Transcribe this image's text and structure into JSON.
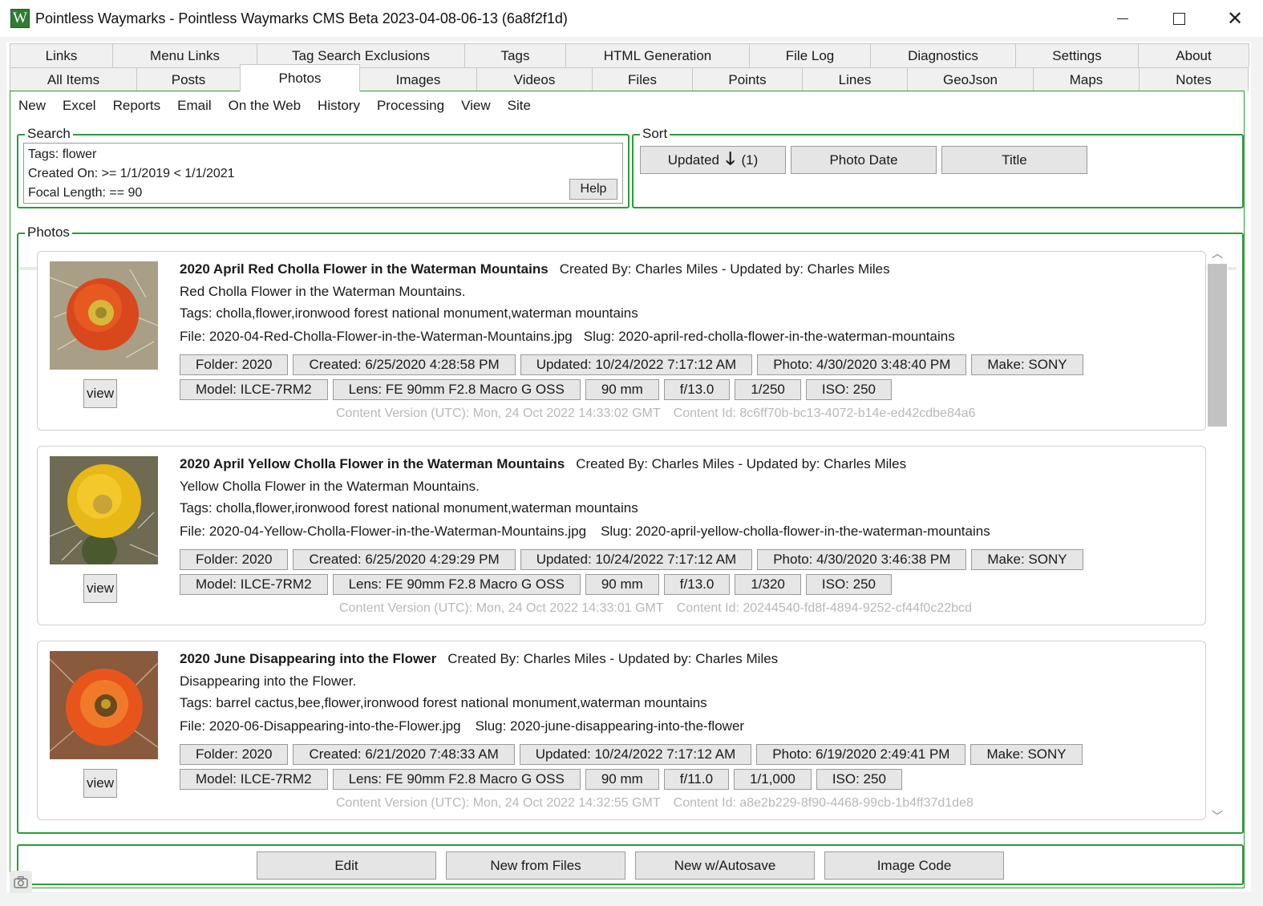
{
  "window": {
    "title": "Pointless Waymarks - Pointless Waymarks CMS Beta   2023-04-08-06-13 (6a8f2f1d)",
    "logo_letter": "W"
  },
  "tabs_top": [
    "Links",
    "Menu Links",
    "Tag Search Exclusions",
    "Tags",
    "HTML Generation",
    "File Log",
    "Diagnostics",
    "Settings",
    "About"
  ],
  "tabs_bottom": [
    "All Items",
    "Posts",
    "Photos",
    "Images",
    "Videos",
    "Files",
    "Points",
    "Lines",
    "GeoJson",
    "Maps",
    "Notes"
  ],
  "active_tab": "Photos",
  "menu": [
    "New",
    "Excel",
    "Reports",
    "Email",
    "On the Web",
    "History",
    "Processing",
    "View",
    "Site"
  ],
  "search": {
    "label": "Search",
    "lines": [
      "Tags: flower",
      "Created On: >= 1/1/2019 < 1/1/2021",
      "Focal Length: == 90"
    ],
    "help_label": "Help"
  },
  "sort": {
    "label": "Sort",
    "updated": "Updated",
    "updated_count": "(1)",
    "photo_date": "Photo Date",
    "title": "Title"
  },
  "photos": {
    "label": "Photos",
    "items": [
      {
        "title": "2020 April Red Cholla Flower in the Waterman Mountains",
        "created_by": "Created By: Charles Miles - Updated by: Charles Miles",
        "summary": "Red Cholla Flower in the Waterman Mountains.",
        "tags": "Tags: cholla,flower,ironwood forest national monument,waterman mountains",
        "file": "File: 2020-04-Red-Cholla-Flower-in-the-Waterman-Mountains.jpg",
        "slug": "Slug: 2020-april-red-cholla-flower-in-the-waterman-mountains",
        "chips1": [
          "Folder: 2020",
          "Created: 6/25/2020 4:28:58 PM",
          "Updated: 10/24/2022 7:17:12 AM",
          "Photo: 4/30/2020 3:48:40 PM",
          "Make: SONY"
        ],
        "chips2": [
          "Model: ILCE-7RM2",
          "Lens: FE 90mm F2.8 Macro G OSS",
          "90 mm",
          "f/13.0",
          "1/250",
          "ISO: 250"
        ],
        "content_version": "Content Version (UTC): Mon, 24 Oct 2022 14:33:02 GMT",
        "content_id": "Content Id: 8c6ff70b-bc13-4072-b14e-ed42cdbe84a6",
        "view_label": "view",
        "color": "#d9481c"
      },
      {
        "title": "2020 April Yellow Cholla Flower in the Waterman Mountains",
        "created_by": "Created By: Charles Miles - Updated by: Charles Miles",
        "summary": "Yellow Cholla Flower in the Waterman Mountains.",
        "tags": "Tags: cholla,flower,ironwood forest national monument,waterman mountains",
        "file": "File: 2020-04-Yellow-Cholla-Flower-in-the-Waterman-Mountains.jpg",
        "slug": "Slug: 2020-april-yellow-cholla-flower-in-the-waterman-mountains",
        "chips1": [
          "Folder: 2020",
          "Created: 6/25/2020 4:29:29 PM",
          "Updated: 10/24/2022 7:17:12 AM",
          "Photo: 4/30/2020 3:46:38 PM",
          "Make: SONY"
        ],
        "chips2": [
          "Model: ILCE-7RM2",
          "Lens: FE 90mm F2.8 Macro G OSS",
          "90 mm",
          "f/13.0",
          "1/320",
          "ISO: 250"
        ],
        "content_version": "Content Version (UTC): Mon, 24 Oct 2022 14:33:01 GMT",
        "content_id": "Content Id: 20244540-fd8f-4894-9252-cf44f0c22bcd",
        "view_label": "view",
        "color": "#e8b816"
      },
      {
        "title": "2020 June Disappearing into the Flower",
        "created_by": "Created By: Charles Miles - Updated by: Charles Miles",
        "summary": "Disappearing into the Flower.",
        "tags": "Tags: barrel cactus,bee,flower,ironwood forest national monument,waterman mountains",
        "file": "File: 2020-06-Disappearing-into-the-Flower.jpg",
        "slug": "Slug: 2020-june-disappearing-into-the-flower",
        "chips1": [
          "Folder: 2020",
          "Created: 6/21/2020 7:48:33 AM",
          "Updated: 10/24/2022 7:17:12 AM",
          "Photo: 6/19/2020 2:49:41 PM",
          "Make: SONY"
        ],
        "chips2": [
          "Model: ILCE-7RM2",
          "Lens: FE 90mm F2.8 Macro G OSS",
          "90 mm",
          "f/11.0",
          "1/1,000",
          "ISO: 250"
        ],
        "content_version": "Content Version (UTC): Mon, 24 Oct 2022 14:32:55 GMT",
        "content_id": "Content Id: a8e2b229-8f90-4468-99cb-1b4ff37d1de8",
        "view_label": "view",
        "color": "#e8551c"
      }
    ]
  },
  "bottom_buttons": {
    "edit": "Edit",
    "new_from_files": "New from Files",
    "new_autosave": "New w/Autosave",
    "image_code": "Image Code"
  },
  "colors": {
    "accent_green": "#2a9d3a"
  }
}
